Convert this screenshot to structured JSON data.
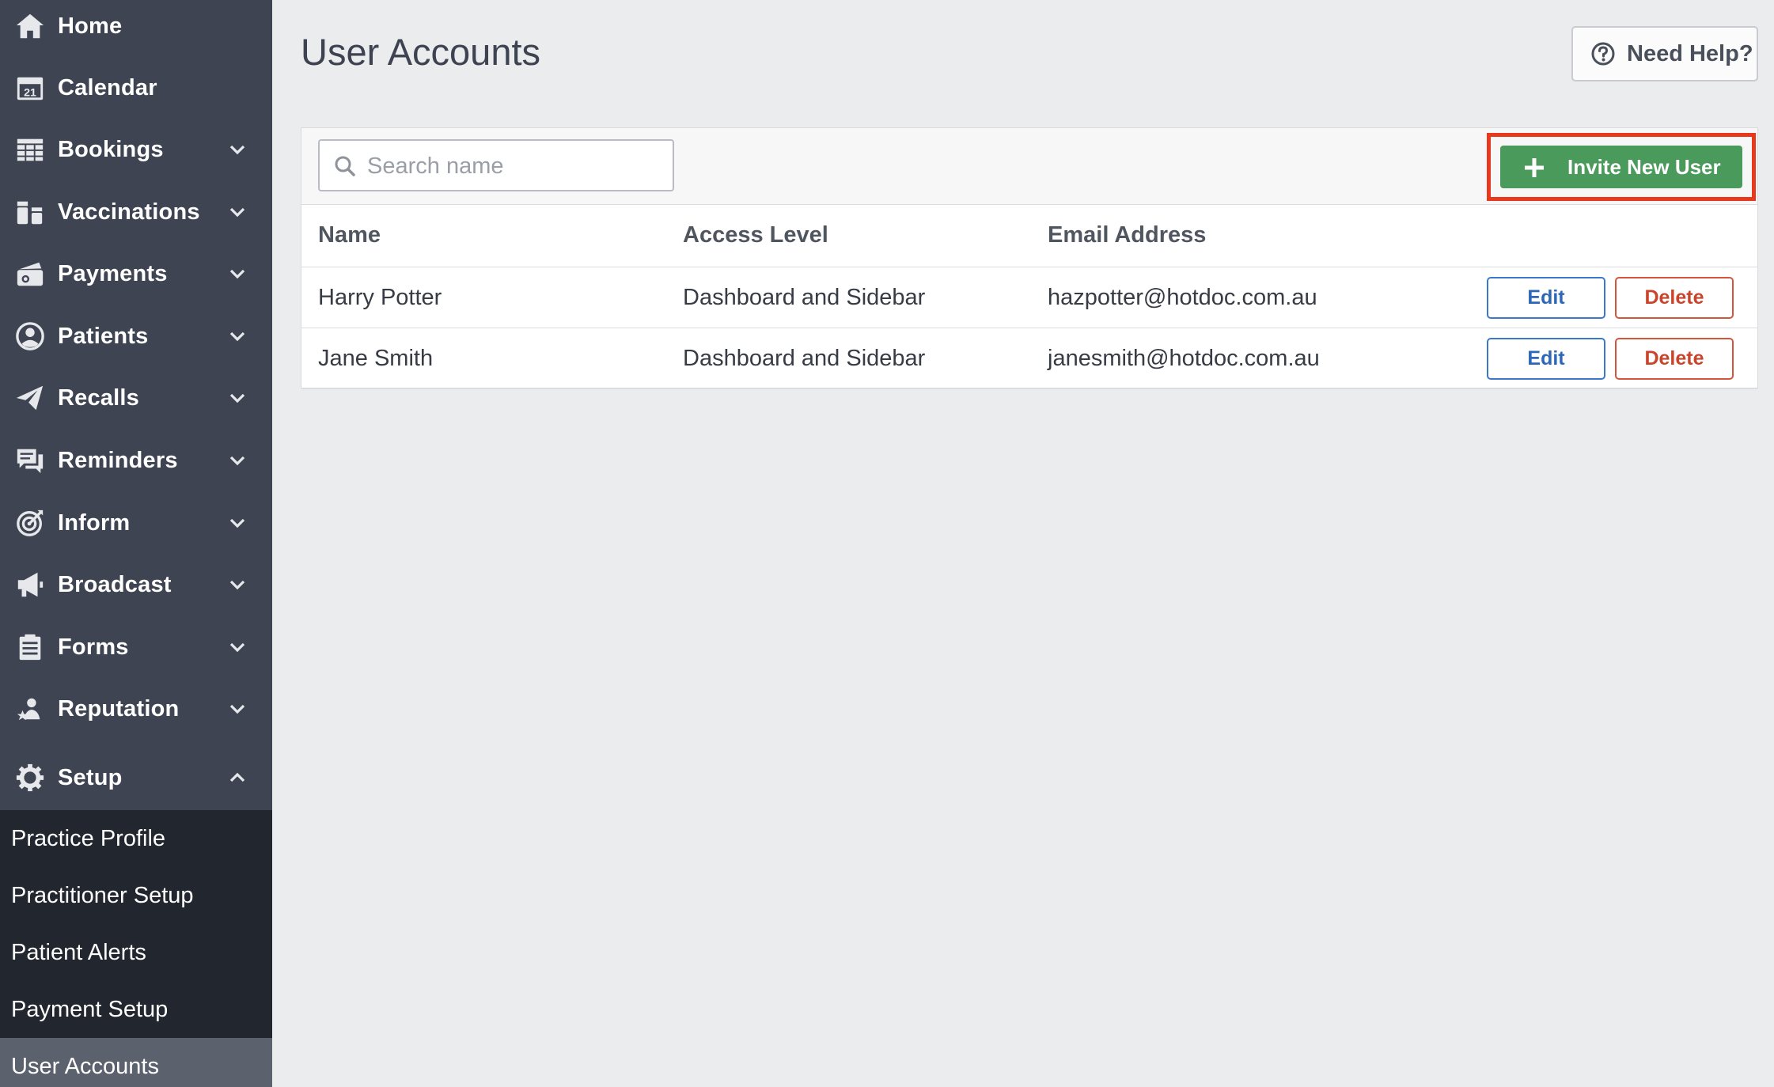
{
  "sidebar": {
    "items": [
      {
        "label": "Home",
        "icon": "home-icon",
        "expandable": false
      },
      {
        "label": "Calendar",
        "icon": "calendar-icon",
        "icon_text": "21",
        "expandable": false
      },
      {
        "label": "Bookings",
        "icon": "table-icon",
        "expandable": true,
        "expanded": false
      },
      {
        "label": "Vaccinations",
        "icon": "vaccine-vial-icon",
        "expandable": true,
        "expanded": false
      },
      {
        "label": "Payments",
        "icon": "payment-card-icon",
        "expandable": true,
        "expanded": false
      },
      {
        "label": "Patients",
        "icon": "user-circle-icon",
        "expandable": true,
        "expanded": false
      },
      {
        "label": "Recalls",
        "icon": "paper-plane-icon",
        "expandable": true,
        "expanded": false
      },
      {
        "label": "Reminders",
        "icon": "chat-bubbles-icon",
        "expandable": true,
        "expanded": false
      },
      {
        "label": "Inform",
        "icon": "target-icon",
        "expandable": true,
        "expanded": false
      },
      {
        "label": "Broadcast",
        "icon": "megaphone-icon",
        "expandable": true,
        "expanded": false
      },
      {
        "label": "Forms",
        "icon": "clipboard-icon",
        "expandable": true,
        "expanded": false
      },
      {
        "label": "Reputation",
        "icon": "user-star-icon",
        "expandable": true,
        "expanded": false
      },
      {
        "label": "Setup",
        "icon": "gear-icon",
        "expandable": true,
        "expanded": true
      }
    ],
    "sub_items": [
      {
        "label": "Practice Profile",
        "active": false
      },
      {
        "label": "Practitioner Setup",
        "active": false
      },
      {
        "label": "Patient Alerts",
        "active": false
      },
      {
        "label": "Payment Setup",
        "active": false
      },
      {
        "label": "User Accounts",
        "active": true
      }
    ]
  },
  "header": {
    "title": "User Accounts",
    "help_label": "Need Help?"
  },
  "toolbar": {
    "search_placeholder": "Search name",
    "search_value": "",
    "invite_label": "Invite New User"
  },
  "table": {
    "columns": [
      "Name",
      "Access Level",
      "Email Address"
    ],
    "rows": [
      {
        "name": "Harry Potter",
        "access": "Dashboard and Sidebar",
        "email": "hazpotter@hotdoc.com.au",
        "edit": "Edit",
        "delete": "Delete"
      },
      {
        "name": "Jane Smith",
        "access": "Dashboard and Sidebar",
        "email": "janesmith@hotdoc.com.au",
        "edit": "Edit",
        "delete": "Delete"
      }
    ]
  },
  "colors": {
    "sidebar_bg": "#3e4452",
    "subnav_bg": "#22262f",
    "active_item_bg": "#5c626d",
    "invite_green": "#4a9a5c",
    "highlight_red": "#e8391f",
    "edit_blue": "#2d67b8",
    "delete_red": "#c9442b"
  }
}
